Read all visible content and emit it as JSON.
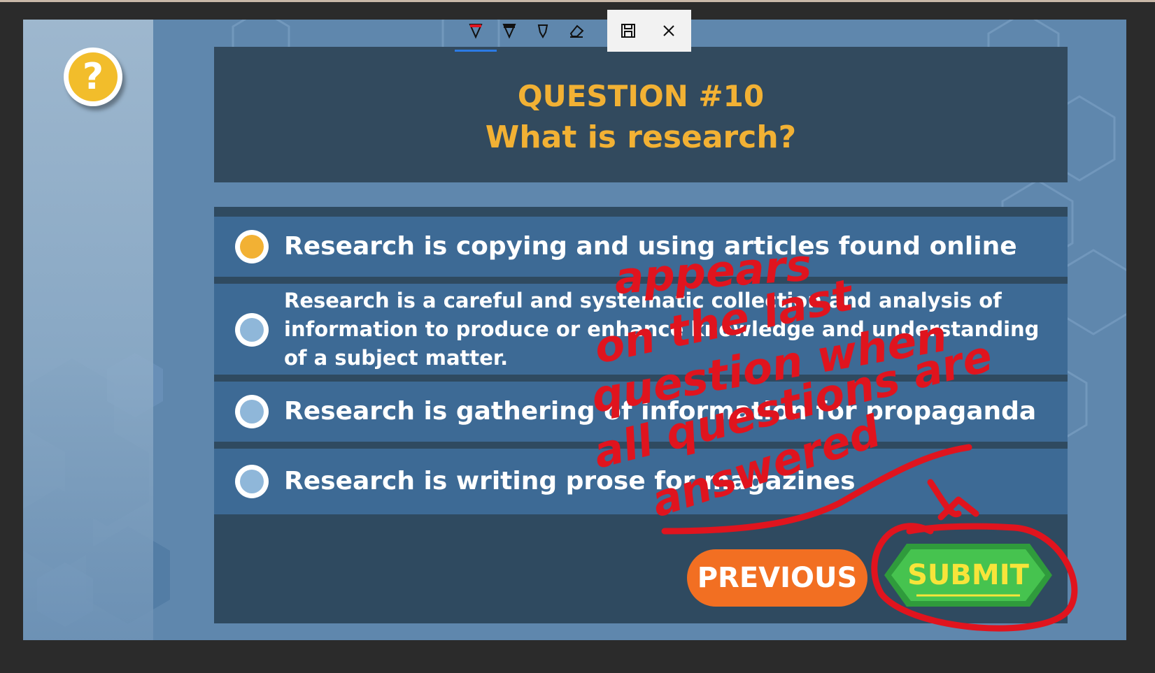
{
  "toolbar": {
    "items": [
      "red-pen-icon",
      "black-pen-icon",
      "highlighter-icon",
      "eraser-icon",
      "save-icon",
      "close-icon"
    ]
  },
  "help": {
    "icon_label": "?"
  },
  "question": {
    "number": "QUESTION #10",
    "text": "What is research?"
  },
  "answers": [
    {
      "text": "Research is copying and using articles found online",
      "selected": true
    },
    {
      "text": "Research is a careful and systematic collection and analysis of information to produce or enhance knowledge and understanding of a subject matter.",
      "selected": false
    },
    {
      "text": "Research is gathering of information for propaganda",
      "selected": false
    },
    {
      "text": "Research is writing prose for magazines",
      "selected": false
    }
  ],
  "buttons": {
    "previous": "PREVIOUS",
    "submit": "SUBMIT"
  },
  "annotation": {
    "text": "appears on the last question when all question are answered"
  },
  "colors": {
    "accent": "#f2b134",
    "previous": "#f26f22",
    "submit": "#3bb34a",
    "ink": "#e0141e"
  }
}
